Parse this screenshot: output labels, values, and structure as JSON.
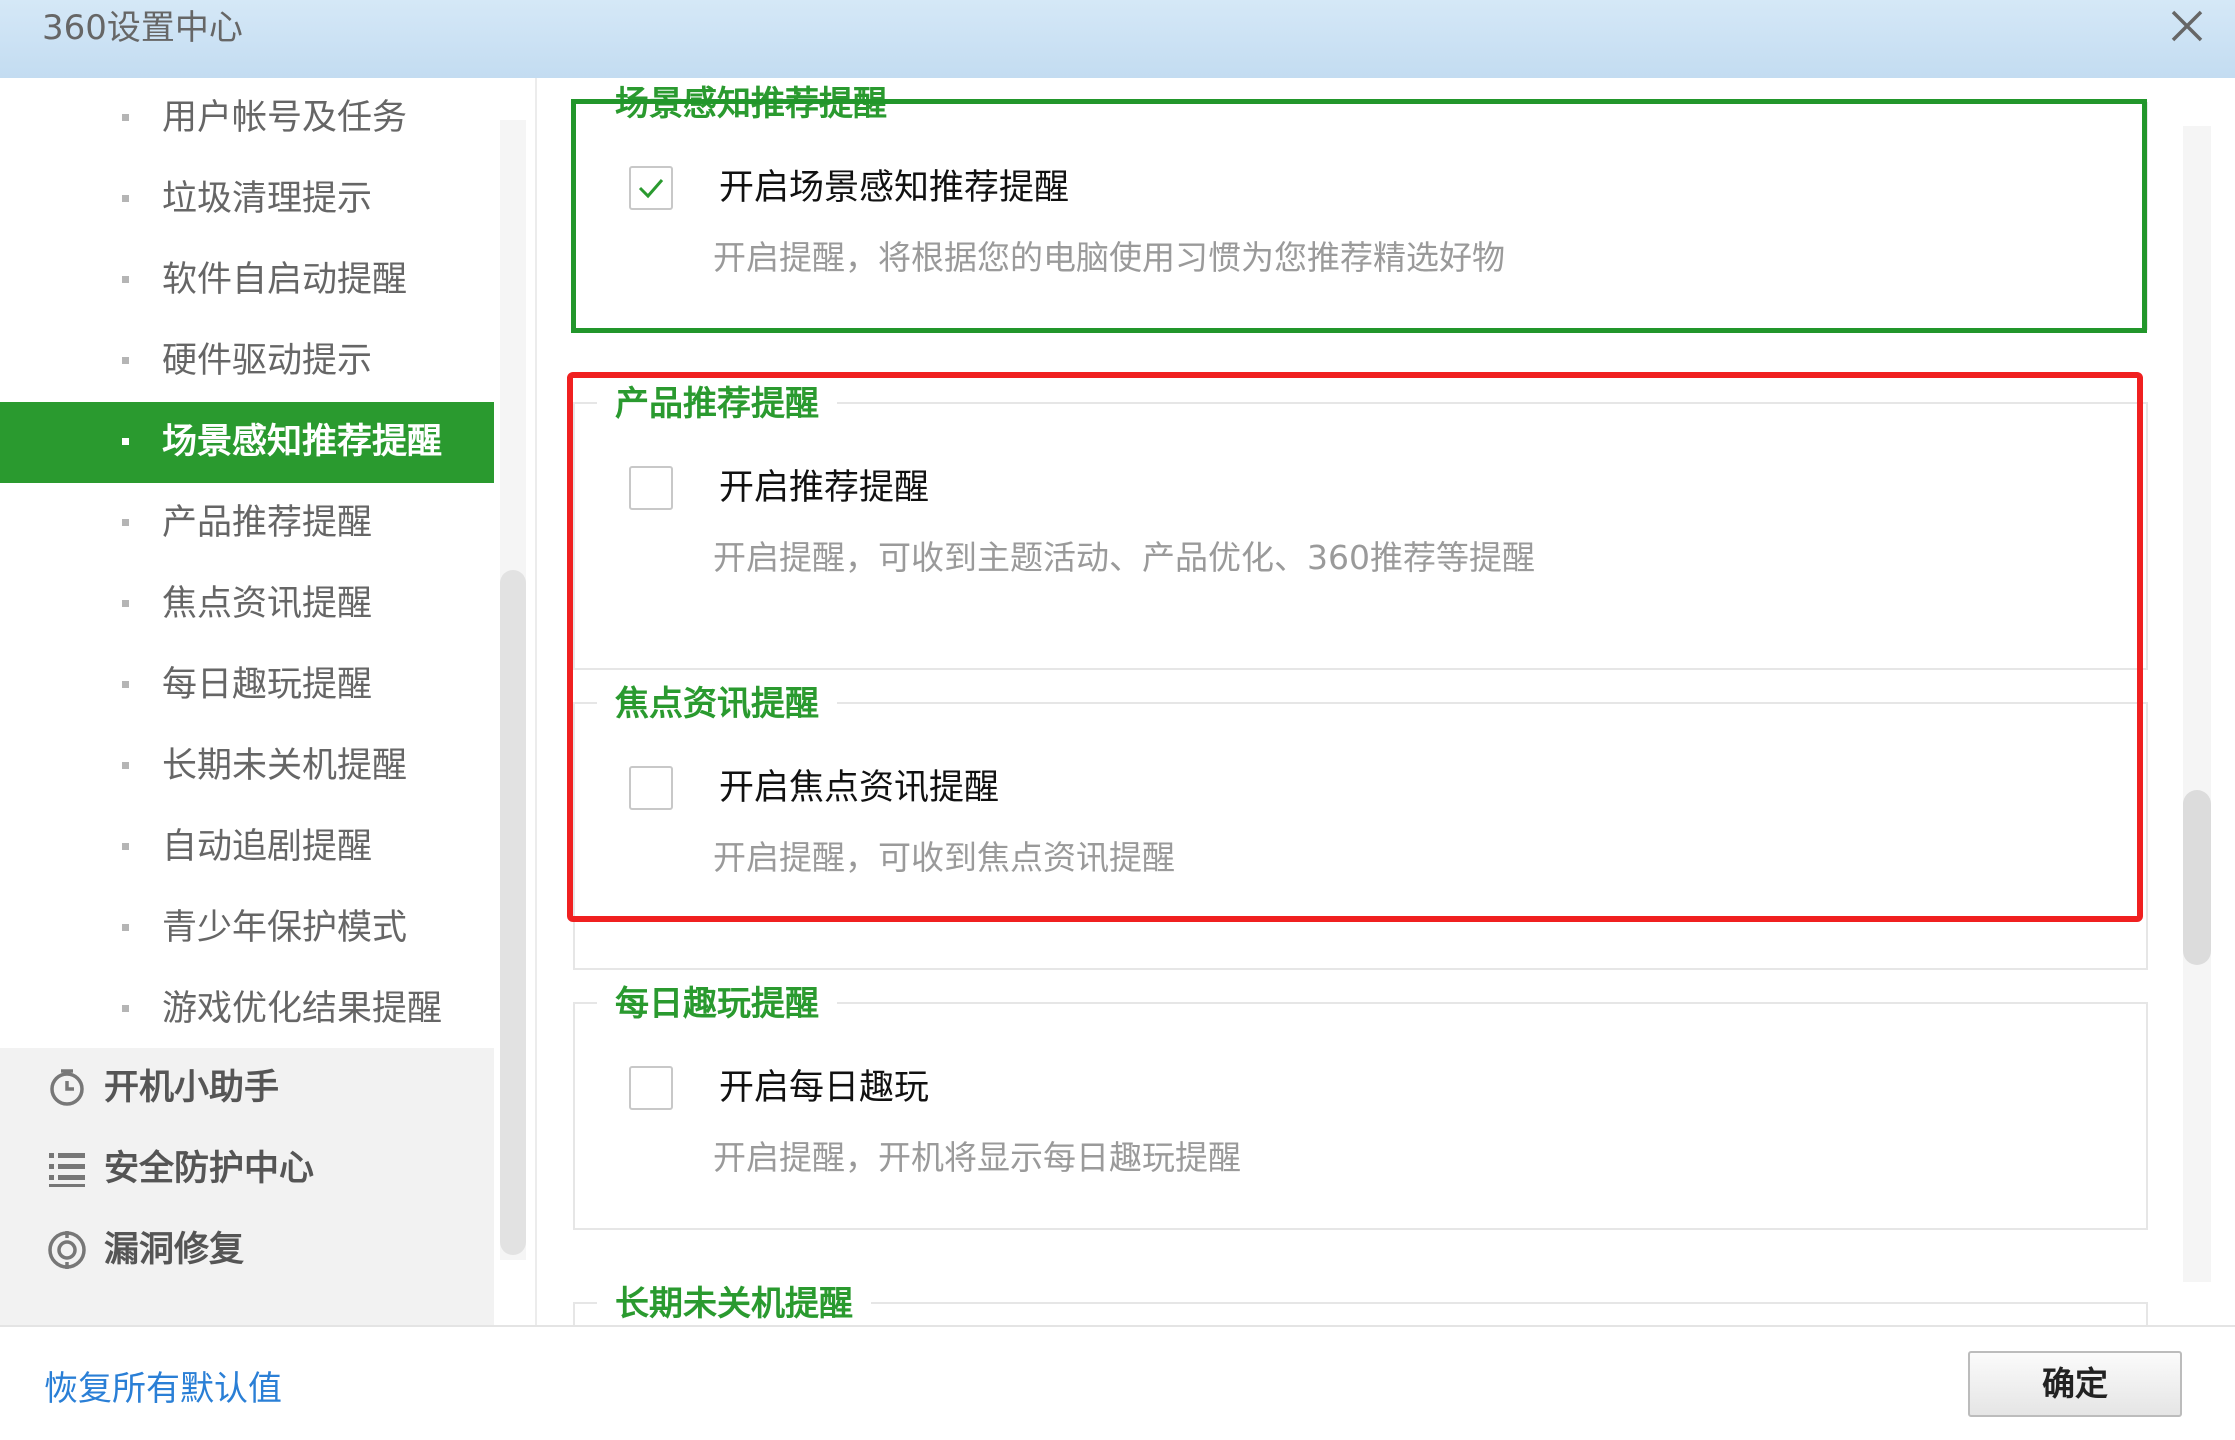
{
  "window": {
    "title": "360设置中心"
  },
  "sidebar": {
    "sub_items": [
      {
        "label": "用户帐号及任务"
      },
      {
        "label": "垃圾清理提示"
      },
      {
        "label": "软件自启动提醒"
      },
      {
        "label": "硬件驱动提示"
      },
      {
        "label": "场景感知推荐提醒",
        "active": true
      },
      {
        "label": "产品推荐提醒"
      },
      {
        "label": "焦点资讯提醒"
      },
      {
        "label": "每日趣玩提醒"
      },
      {
        "label": "长期未关机提醒"
      },
      {
        "label": "自动追剧提醒"
      },
      {
        "label": "青少年保护模式"
      },
      {
        "label": "游戏优化结果提醒"
      }
    ],
    "categories": [
      {
        "label": "开机小助手",
        "icon": "clock-icon"
      },
      {
        "label": "安全防护中心",
        "icon": "list-icon"
      },
      {
        "label": "漏洞修复",
        "icon": "target-icon"
      }
    ]
  },
  "sections": [
    {
      "title": "场景感知推荐提醒",
      "checkbox_label": "开启场景感知推荐提醒",
      "checked": true,
      "description": "开启提醒，将根据您的电脑使用习惯为您推荐精选好物"
    },
    {
      "title": "产品推荐提醒",
      "checkbox_label": "开启推荐提醒",
      "checked": false,
      "description": "开启提醒，可收到主题活动、产品优化、360推荐等提醒"
    },
    {
      "title": "焦点资讯提醒",
      "checkbox_label": "开启焦点资讯提醒",
      "checked": false,
      "description": "开启提醒，可收到焦点资讯提醒"
    },
    {
      "title": "每日趣玩提醒",
      "checkbox_label": "开启每日趣玩",
      "checked": false,
      "description": "开启提醒，开机将显示每日趣玩提醒"
    },
    {
      "title": "长期未关机提醒"
    }
  ],
  "footer": {
    "restore_label": "恢复所有默认值",
    "ok_label": "确定"
  },
  "colors": {
    "accent_green": "#2a9a2f",
    "highlight_red": "#f02020",
    "link_blue": "#2a7fd6"
  }
}
